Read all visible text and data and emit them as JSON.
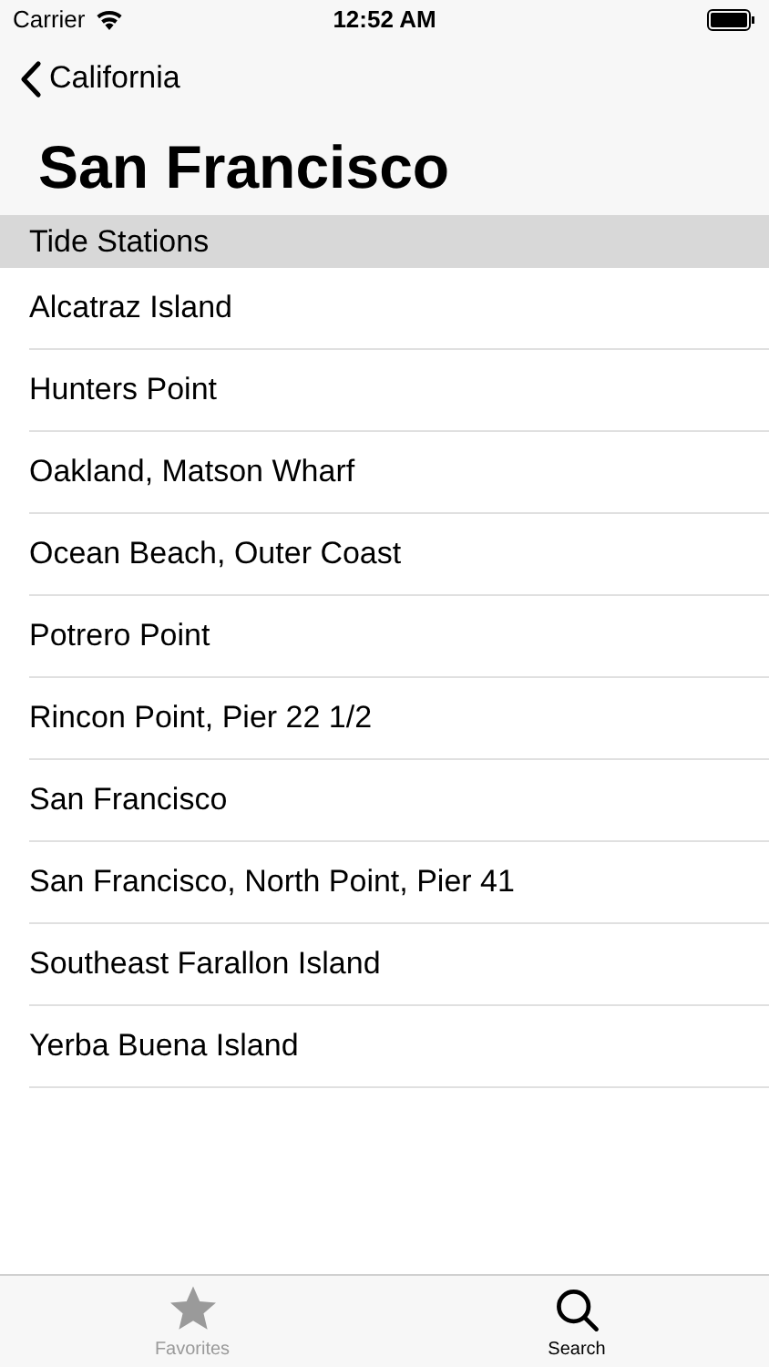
{
  "status_bar": {
    "carrier": "Carrier",
    "time": "12:52 AM"
  },
  "nav": {
    "back_label": "California",
    "title": "San Francisco"
  },
  "section": {
    "title": "Tide Stations"
  },
  "rows": [
    {
      "label": "Alcatraz Island"
    },
    {
      "label": "Hunters Point"
    },
    {
      "label": "Oakland, Matson Wharf"
    },
    {
      "label": "Ocean Beach, Outer Coast"
    },
    {
      "label": "Potrero Point"
    },
    {
      "label": "Rincon Point, Pier 22 1/2"
    },
    {
      "label": "San Francisco"
    },
    {
      "label": "San Francisco, North Point, Pier 41"
    },
    {
      "label": "Southeast Farallon Island"
    },
    {
      "label": "Yerba Buena Island"
    }
  ],
  "tab_bar": [
    {
      "label": "Favorites",
      "kind": "star",
      "selected": false
    },
    {
      "label": "Search",
      "kind": "search",
      "selected": true
    }
  ]
}
